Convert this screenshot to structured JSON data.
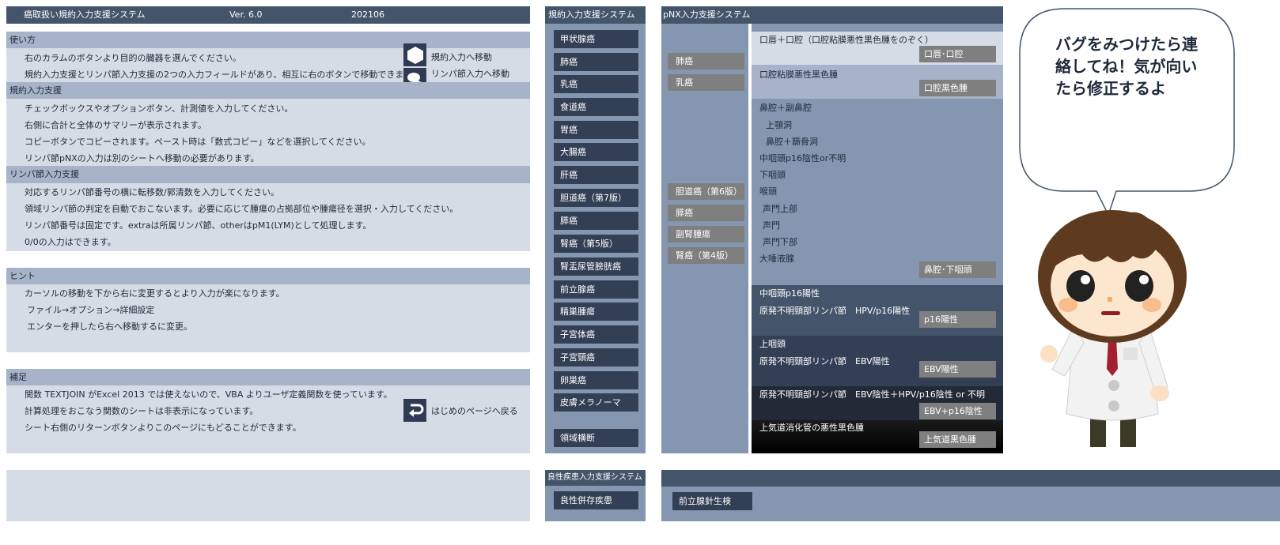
{
  "title_bar": {
    "app_title": "癌取扱い規約入力支援システム",
    "version": "Ver. 6.0",
    "date": "202106"
  },
  "usage": {
    "header": "使い方",
    "lines": [
      "右のカラムのボタンより目的の臓器を選んでください。",
      "規約入力支援とリンパ節入力支援の2つの入力フィールドがあり、相互に右のボタンで移動できます。"
    ],
    "icon_labels": [
      "規約入力へ移動",
      "リンパ節入力へ移動"
    ]
  },
  "kiyaku": {
    "header": "規約入力支援",
    "lines": [
      "チェックボックスやオプションボタン、計測値を入力してください。",
      "右側に合計と全体のサマリーが表示されます。",
      "コピーボタンでコピーされます。ペースト時は「数式コピー」などを選択してください。",
      "リンパ節pNXの入力は別のシートへ移動の必要があります。"
    ]
  },
  "lymph": {
    "header": "リンパ節入力支援",
    "lines": [
      "対応するリンパ節番号の横に転移数/郭清数を入力してください。",
      "領域リンパ節の判定を自動でおこないます。必要に応じて腫瘍の占拠部位や腫瘍径を選択・入力してください。",
      "リンパ節番号は固定です。extraは所属リンパ節、otherはpM1(LYM)として処理します。",
      "0/0の入力はできます。"
    ]
  },
  "hint": {
    "header": "ヒント",
    "lines": [
      "カーソルの移動を下から右に変更するとより入力が楽になります。",
      "ファイル→オプション→詳細設定",
      "エンターを押したら右へ移動するに変更。"
    ]
  },
  "supplement": {
    "header": "補足",
    "lines": [
      "関数 TEXTJOIN がExcel 2013 では使えないので、VBA よりユーザ定義関数を使っています。",
      "計算処理をおこなう関数のシートは非表示になっています。",
      "シート右側のリターンボタンよりこのページにもどることができます。"
    ],
    "return_label": "はじめのページへ戻る"
  },
  "nav": {
    "header": "規約入力支援システム",
    "items": [
      "甲状腺癌",
      "肺癌",
      "乳癌",
      "食道癌",
      "胃癌",
      "大腸癌",
      "肝癌",
      "胆道癌（第7版）",
      "膵癌",
      "腎癌（第5版）",
      "腎盂尿管膀胱癌",
      "前立腺癌",
      "精巣腫瘍",
      "子宮体癌",
      "子宮頸癌",
      "卵巣癌",
      "皮膚メラノーマ",
      "領域横断"
    ]
  },
  "benign": {
    "header": "良性疾患入力支援システム",
    "button": "良性併存疾患"
  },
  "pnx": {
    "header": "pNX入力支援システム",
    "left_buttons": [
      "肺癌",
      "乳癌",
      "胆道癌（第6版）",
      "膵癌",
      "副腎腫瘍",
      "腎癌（第4版）"
    ],
    "blocks": [
      {
        "lines": [
          "口唇＋口腔（口腔粘膜悪性黒色腫をのぞく）"
        ],
        "button": "口唇･口腔"
      },
      {
        "lines": [
          "口腔粘膜悪性黒色腫"
        ],
        "button": "口腔黒色腫"
      },
      {
        "lines": [
          "鼻腔＋副鼻腔",
          "上顎洞",
          "鼻腔＋篩骨洞",
          "中咽頭p16陰性or不明",
          "下咽頭",
          "喉頭",
          "声門上部",
          "声門",
          "声門下部",
          "大唾液腺"
        ],
        "button": "鼻腔･下咽頭"
      },
      {
        "lines": [
          "中咽頭p16陽性",
          "原発不明頸部リンパ節　HPV/p16陽性"
        ],
        "button": "p16陽性"
      },
      {
        "lines": [
          "上咽頭",
          "原発不明頸部リンパ節　EBV陽性"
        ],
        "button": "EBV陽性"
      },
      {
        "lines": [
          "原発不明頸部リンパ節　EBV陰性＋HPV/p16陰性 or 不明"
        ],
        "button": "EBV+p16陰性"
      },
      {
        "lines": [
          "上気道消化管の悪性黒色腫"
        ],
        "button": "上気道黒色腫"
      }
    ]
  },
  "bottom_right": {
    "button": "前立腺針生検"
  },
  "speech": {
    "text": "バグをみつけたら連絡してね！気が向いたら修正するよ"
  }
}
